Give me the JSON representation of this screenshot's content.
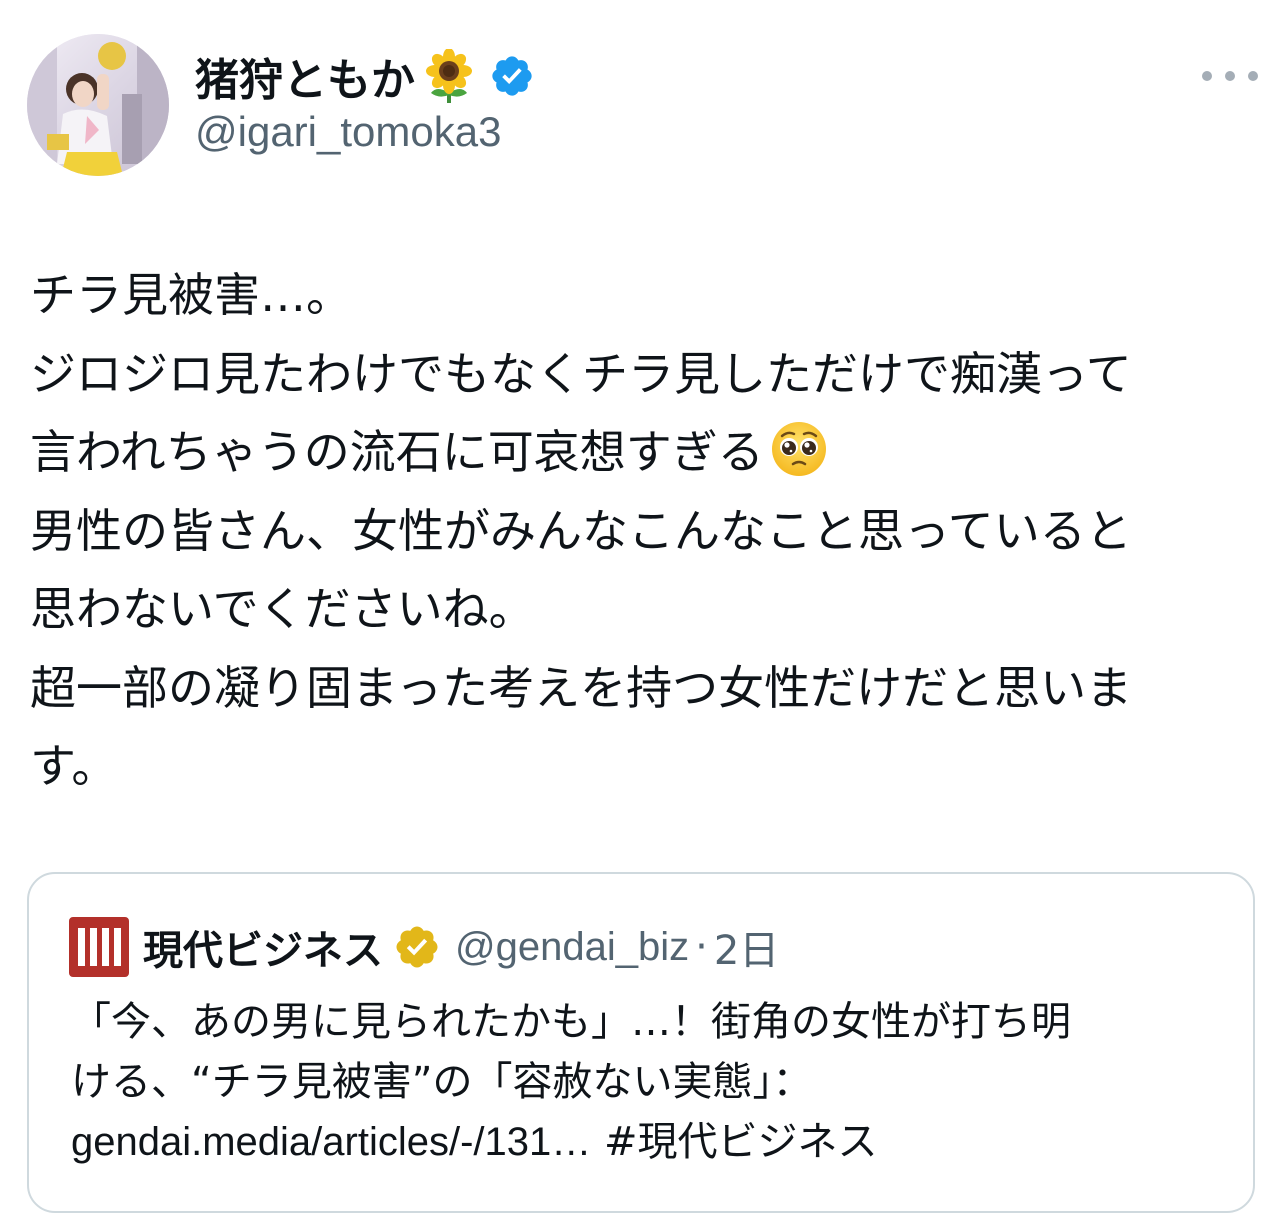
{
  "author": {
    "display_name": "猪狩ともか",
    "name_emoji_icon": "sunflower-icon",
    "verified_icon": "verified-blue-icon",
    "handle": "@igari_tomoka3"
  },
  "more_icon": "more-horizontal-icon",
  "tweet": {
    "lines": [
      "チラ見被害…。",
      "ジロジロ見たわけでもなくチラ見しただけで痴漢って",
      "言われちゃうの流石に可哀想すぎる",
      "男性の皆さん、女性がみんなこんなこと思っていると",
      "思わないでくださいね。",
      "超一部の凝り固まった考えを持つ女性だけだと思いま",
      "す。"
    ],
    "inline_emoji_icon": "pleading-face-icon"
  },
  "quote": {
    "logo_icon": "gendai-logo-icon",
    "name": "現代ビジネス",
    "verified_icon": "verified-gold-icon",
    "handle": "@gendai_biz",
    "separator": "·",
    "time": "2日",
    "lines": [
      "「今、あの男に見られたかも」…！街角の女性が打ち明",
      "ける、“チラ見被害”の「容赦ない実態」："
    ],
    "url": "gendai.media/articles/-/131…",
    "hashtag": "#現代ビジネス"
  },
  "colors": {
    "text_primary": "#0f1419",
    "text_secondary": "#536471",
    "verified_blue": "#1d9bf0",
    "verified_gold": "#e2b719",
    "card_border": "#cfd9de",
    "gendai_red": "#b3302a"
  }
}
